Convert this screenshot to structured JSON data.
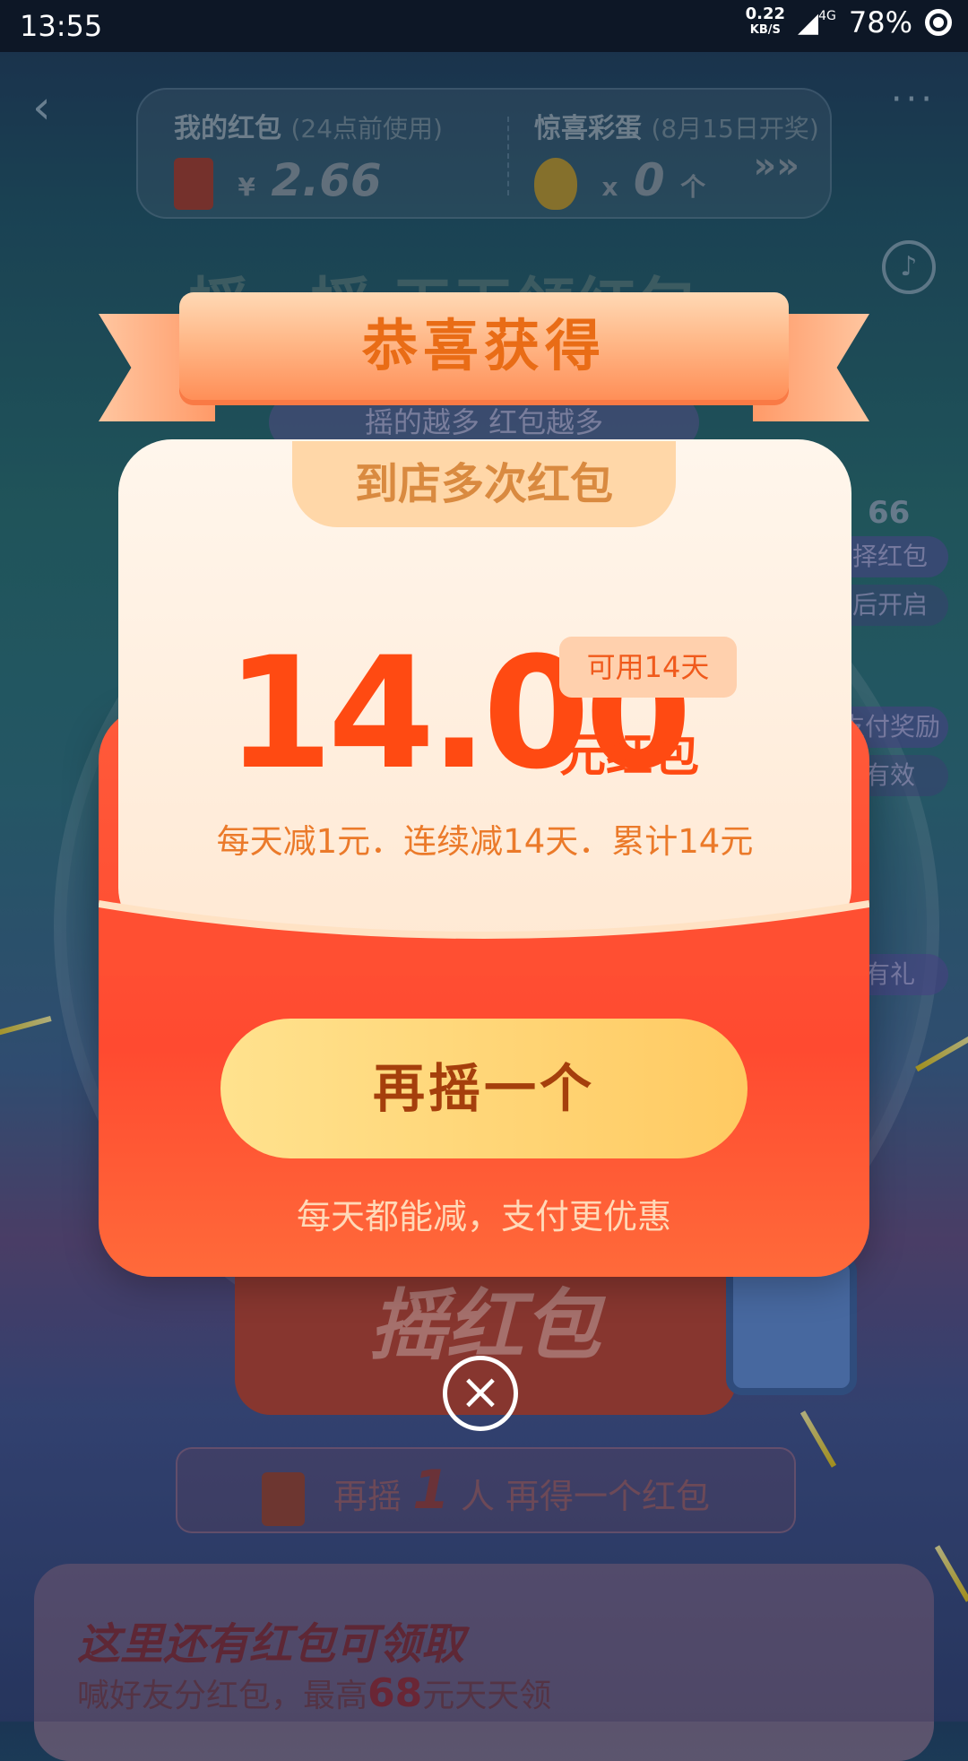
{
  "statusbar": {
    "time": "13:55",
    "net_speed": "0.22",
    "net_unit": "KB/S",
    "signal": "4G",
    "battery": "78%"
  },
  "header": {
    "back_icon": "chevron-left-icon",
    "more_icon": "more-icon"
  },
  "topcard": {
    "redpacket_title": "我的红包",
    "redpacket_note": "(24点前使用)",
    "redpacket_currency": "¥",
    "redpacket_amount": "2.66",
    "egg_title": "惊喜彩蛋",
    "egg_note": "(8月15日开奖)",
    "egg_count_prefix": "x",
    "egg_count": "0",
    "egg_count_unit": "个",
    "arrows": "»»"
  },
  "background": {
    "title": "摇一摇 天天领红包",
    "subtitle": "摇的越多 红包越多",
    "side_tags": [
      "择红包",
      "后开启",
      "支付奖励",
      "有效",
      "有礼"
    ],
    "side_amount": "66",
    "shake_label": "摇红包",
    "hint_prefix": "再摇",
    "hint_count": "1",
    "hint_suffix": "人 再得一个红包",
    "bottom_title": "这里还有红包可领取",
    "bottom_sub_prefix": "喊好友分红包，最高",
    "bottom_sub_amount": "68",
    "bottom_sub_suffix": "元天天领"
  },
  "modal": {
    "banner": "恭喜获得",
    "packet_type": "到店多次红包",
    "amount": "14.00",
    "unit": "元红包",
    "validity": "可用14天",
    "description": "每天减1元．连续减14天．累计14元",
    "cta": "再摇一个",
    "cta_note": "每天都能减，支付更优惠",
    "close_icon": "close-icon"
  },
  "colors": {
    "accent": "#ff4a12",
    "cta_text": "#a53f0c",
    "red_panel": "#ff5a3a"
  }
}
